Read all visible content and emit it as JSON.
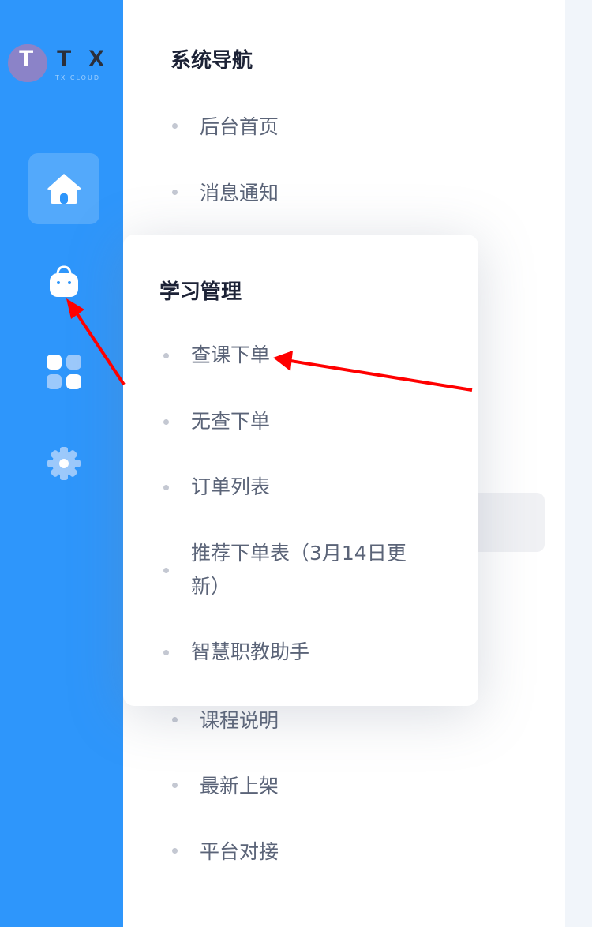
{
  "logo": {
    "letters": [
      "T",
      "T",
      "X"
    ],
    "subtitle": "TX CLOUD"
  },
  "rail": {
    "icons": [
      {
        "name": "home-icon",
        "active": true
      },
      {
        "name": "shopping-bag-icon",
        "active": false
      },
      {
        "name": "apps-grid-icon",
        "active": false
      },
      {
        "name": "gear-icon",
        "active": false
      }
    ]
  },
  "nav": {
    "title": "系统导航",
    "items": [
      "后台首页",
      "消息通知",
      "课程说明",
      "最新上架",
      "平台对接"
    ]
  },
  "popup": {
    "title": "学习管理",
    "items": [
      "查课下单",
      "无查下单",
      "订单列表",
      "推荐下单表（3月14日更新）",
      "智慧职教助手"
    ]
  },
  "colors": {
    "rail": "#2e96fb",
    "annotation_arrow": "#ff0000",
    "text_primary": "#1c2236",
    "text_secondary": "#5b6478"
  }
}
